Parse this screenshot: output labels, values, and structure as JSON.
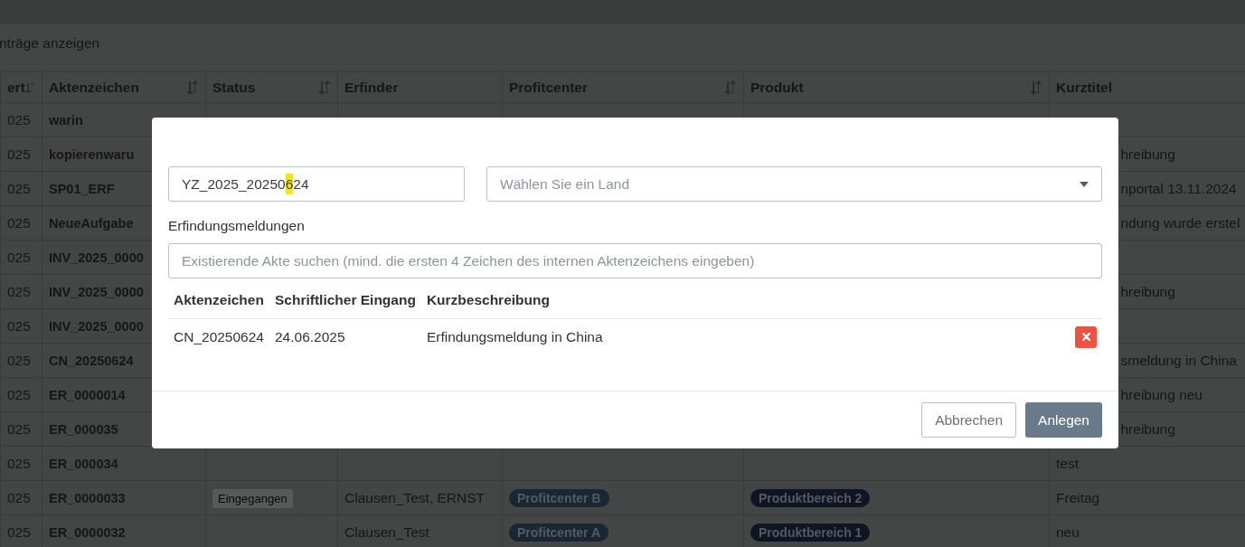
{
  "length_text": "nträge anzeigen",
  "table": {
    "columns": [
      {
        "label": "ert",
        "sortable": true,
        "sorted": true
      },
      {
        "label": "Aktenzeichen",
        "sortable": true,
        "sorted": false
      },
      {
        "label": "Status",
        "sortable": true,
        "sorted": false
      },
      {
        "label": "Erfinder",
        "sortable": false,
        "sorted": false
      },
      {
        "label": "Profitcenter",
        "sortable": true,
        "sorted": false
      },
      {
        "label": "Produkt",
        "sortable": true,
        "sorted": false
      },
      {
        "label": "Kurztitel"
      }
    ],
    "rows": [
      {
        "column_1": "025",
        "aktenzeichen": "warin"
      },
      {
        "column_1": "025",
        "aktenzeichen": "kopierenwaru",
        "kurztitel": "hreibung"
      },
      {
        "column_1": "025",
        "aktenzeichen": "SP01_ERF",
        "kurztitel": "nportal 13.11.2024"
      },
      {
        "column_1": "025",
        "aktenzeichen": "NeueAufgabe",
        "kurztitel": "ndung wurde erstel"
      },
      {
        "column_1": "025",
        "aktenzeichen": "INV_2025_0000"
      },
      {
        "column_1": "025",
        "aktenzeichen": "INV_2025_0000",
        "kurztitel": "hreibung"
      },
      {
        "column_1": "025",
        "aktenzeichen": "INV_2025_0000"
      },
      {
        "column_1": "025",
        "aktenzeichen": "CN_20250624",
        "kurztitel": "smeldung in China"
      },
      {
        "column_1": "025",
        "aktenzeichen": "ER_0000014",
        "kurztitel": "hreibung neu"
      },
      {
        "column_1": "025",
        "aktenzeichen": "ER_000035",
        "kurztitel": "hreibung"
      },
      {
        "column_1": "025",
        "aktenzeichen": "ER_000034",
        "kurztitel": "test"
      },
      {
        "column_1": "025",
        "aktenzeichen": "ER_0000033",
        "status": "Eingegangen",
        "erfinder": "Clausen_Test, ERNST",
        "profitcenter": "Profitcenter B",
        "produkt": "Produktbereich 2",
        "kurztitel": "Freitag"
      },
      {
        "column_1": "025",
        "aktenzeichen": "ER_0000032",
        "erfinder": "Clausen_Test",
        "profitcenter": "Profitcenter A",
        "produkt": "Produktbereich 1",
        "kurztitel": "neu"
      }
    ]
  },
  "dialog": {
    "file_number": {
      "value_before": "YZ_2025_20250",
      "highlight": "6",
      "value_after": "24"
    },
    "country_select": {
      "placeholder": "Wählen Sie ein Land"
    },
    "section_label": "Erfindungsmeldungen",
    "search": {
      "placeholder": "Existierende Akte suchen (mind. die ersten 4 Zeichen des internen Aktenzeichens eingeben)"
    },
    "table": {
      "columns": [
        "Aktenzeichen",
        "Schriftlicher Eingang",
        "Kurzbeschreibung"
      ],
      "rows": [
        {
          "aktenzeichen": "CN_20250624",
          "eingang": "24.06.2025",
          "kurzbeschreibung": "Erfindungsmeldung in China"
        }
      ]
    },
    "buttons": [
      {
        "label": "Abbrechen",
        "kind": "cancel"
      },
      {
        "label": "Anlegen",
        "kind": "primary"
      }
    ]
  }
}
